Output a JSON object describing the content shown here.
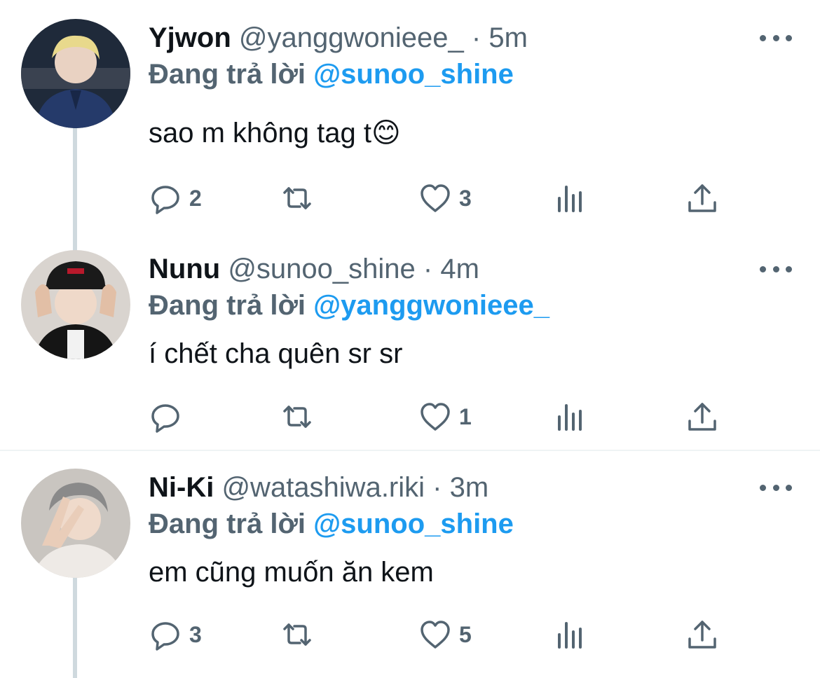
{
  "tweets": [
    {
      "name": "Yjwon",
      "handle": "@yanggwonieee_",
      "dot": "·",
      "time": "5m",
      "replying_prefix": "Đang trả lời",
      "replying_to": "@sunoo_shine",
      "text": "sao m không tag t😊",
      "reply_count": "2",
      "retweet_count": "",
      "like_count": "3"
    },
    {
      "name": "Nunu",
      "handle": "@sunoo_shine",
      "dot": "·",
      "time": "4m",
      "replying_prefix": "Đang trả lời",
      "replying_to": "@yanggwonieee_",
      "text": "í chết cha quên sr sr",
      "reply_count": "",
      "retweet_count": "",
      "like_count": "1"
    },
    {
      "name": "Ni-Ki",
      "handle": "@watashiwa.riki",
      "dot": "·",
      "time": "3m",
      "replying_prefix": "Đang trả lời",
      "replying_to": "@sunoo_shine",
      "text": "em cũng muốn ăn kem",
      "reply_count": "3",
      "retweet_count": "",
      "like_count": "5"
    }
  ],
  "icons": {
    "reply": "reply-icon",
    "retweet": "retweet-icon",
    "like": "heart-icon",
    "analytics": "analytics-icon",
    "share": "share-icon",
    "more": "more-icon"
  },
  "colors": {
    "mention": "#1d9bf0",
    "secondary_text": "#536471",
    "thread_line": "#cfd9de"
  }
}
